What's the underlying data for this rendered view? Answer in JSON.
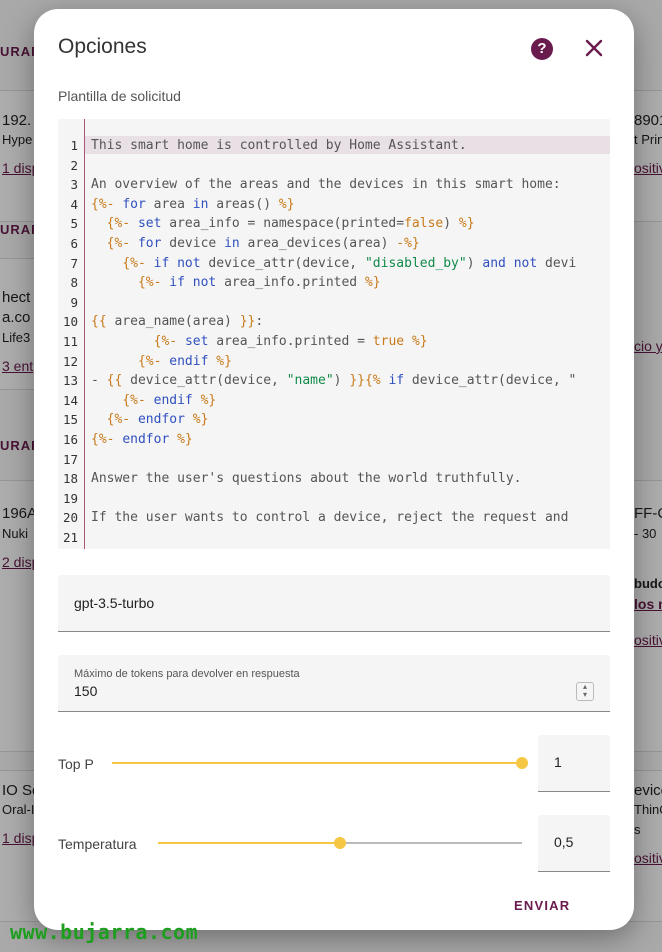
{
  "background": {
    "left_texts": [
      "URAR",
      "192.",
      "Hype",
      "1 disp",
      "URAR",
      "hect",
      "a.co",
      "Life3",
      "3 ent",
      "URAR",
      "196A",
      "Nuki",
      "2 disp",
      "IO Se",
      "Oral-I",
      "1 disp"
    ],
    "right_texts": [
      "8901",
      "t Prin",
      "ositiv",
      "cio y",
      "FF-C",
      "- 30",
      "budo",
      "los n",
      "ositiv",
      "evice",
      "ThinQ",
      "s",
      "ositiv"
    ],
    "watermark": "www.bujarra.com"
  },
  "dialog": {
    "title": "Opciones",
    "help_icon": "help-circle-icon",
    "close_icon": "close-icon",
    "prompt_label": "Plantilla de solicitud",
    "code_lines": [
      "This smart home is controlled by Home Assistant.",
      "",
      "An overview of the areas and the devices in this smart home:",
      "{%- for area in areas() %}",
      "  {%- set area_info = namespace(printed=false) %}",
      "  {%- for device in area_devices(area) -%}",
      "    {%- if not device_attr(device, \"disabled_by\") and not devi",
      "      {%- if not area_info.printed %}",
      "",
      "{{ area_name(area) }}:",
      "        {%- set area_info.printed = true %}",
      "      {%- endif %}",
      "- {{ device_attr(device, \"name\") }}{% if device_attr(device, \"",
      "    {%- endif %}",
      "  {%- endfor %}",
      "{%- endfor %}",
      "",
      "Answer the user's questions about the world truthfully.",
      "",
      "If the user wants to control a device, reject the request and",
      ""
    ],
    "model_value": "gpt-3.5-turbo",
    "max_tokens_label": "Máximo de tokens para devolver en respuesta",
    "max_tokens_value": "150",
    "top_p_label": "Top P",
    "top_p_value": "1",
    "top_p_fraction": 1.0,
    "temperature_label": "Temperatura",
    "temperature_value": "0,5",
    "temperature_fraction": 0.5,
    "send_label": "ENVIAR",
    "accent_color": "#6a1b4d",
    "slider_color": "#f6c744"
  }
}
